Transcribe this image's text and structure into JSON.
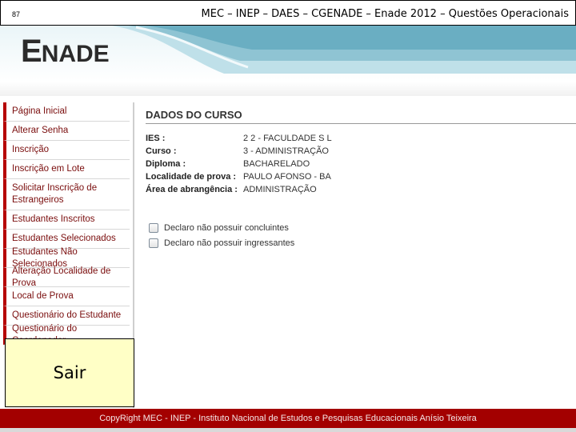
{
  "slide": {
    "number": "87",
    "title": "MEC – INEP – DAES – CGENADE – Enade 2012 – Questões Operacionais"
  },
  "logo": {
    "big": "E",
    "rest": "NADE"
  },
  "sidebar": {
    "items": [
      {
        "label": "Página Inicial"
      },
      {
        "label": "Alterar Senha"
      },
      {
        "label": "Inscrição"
      },
      {
        "label": "Inscrição em Lote"
      },
      {
        "label": "Solicitar Inscrição de Estrangeiros"
      },
      {
        "label": "Estudantes Inscritos"
      },
      {
        "label": "Estudantes Selecionados"
      },
      {
        "label": "Estudantes Não Selecionados"
      },
      {
        "label": "Alteração Localidade de Prova"
      },
      {
        "label": "Local de Prova"
      },
      {
        "label": "Questionário do Estudante"
      },
      {
        "label": "Questionário do Coordenador"
      }
    ]
  },
  "sair": {
    "label": "Sair"
  },
  "course": {
    "section_title": "DADOS DO CURSO",
    "fields": [
      {
        "label": "IES :",
        "value": "2   2 - FACULDADE S   L"
      },
      {
        "label": "Curso :",
        "value": "     3 - ADMINISTRAÇÃO"
      },
      {
        "label": "Diploma :",
        "value": "BACHARELADO"
      },
      {
        "label": "Localidade de prova :",
        "value": "PAULO AFONSO - BA"
      },
      {
        "label": "Área de abrangência :",
        "value": "ADMINISTRAÇÃO"
      }
    ]
  },
  "checks": [
    {
      "label": "Declaro não possuir concluintes",
      "checked": false
    },
    {
      "label": "Declaro não possuir ingressantes",
      "checked": false
    }
  ],
  "footer": {
    "text": "CopyRight MEC - INEP - Instituto Nacional de Estudos e Pesquisas Educacionais Anísio Teixeira"
  },
  "colors": {
    "accent_red": "#b60000",
    "footer_red": "#a30000",
    "sair_background": "#ffffc6",
    "banner_teal": "#8fc4d3"
  }
}
